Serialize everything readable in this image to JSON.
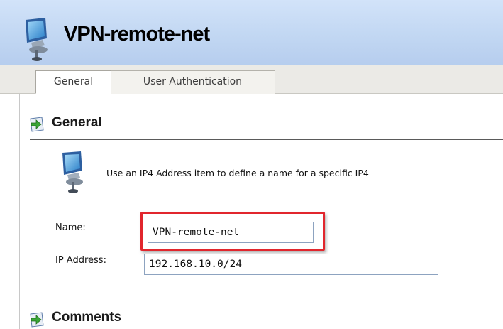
{
  "header": {
    "title": "VPN-remote-net",
    "icon": "network-computer-icon"
  },
  "tabs": [
    {
      "label": "General",
      "selected": true
    },
    {
      "label": "User Authentication",
      "selected": false
    }
  ],
  "sections": {
    "general": {
      "title": "General",
      "icon": "expand-arrow-icon"
    },
    "comments": {
      "title": "Comments",
      "icon": "expand-arrow-icon"
    }
  },
  "info": {
    "icon": "network-computer-icon",
    "text": "Use an IP4 Address item to define a name for a specific IP4"
  },
  "form": {
    "name_label": "Name:",
    "name_value": "VPN-remote-net",
    "ip_label": "IP Address:",
    "ip_value": "192.168.10.0/24"
  },
  "colors": {
    "header_bg": "#c3d8f3",
    "highlight": "#e1262d",
    "input_border": "#8da3c0"
  }
}
